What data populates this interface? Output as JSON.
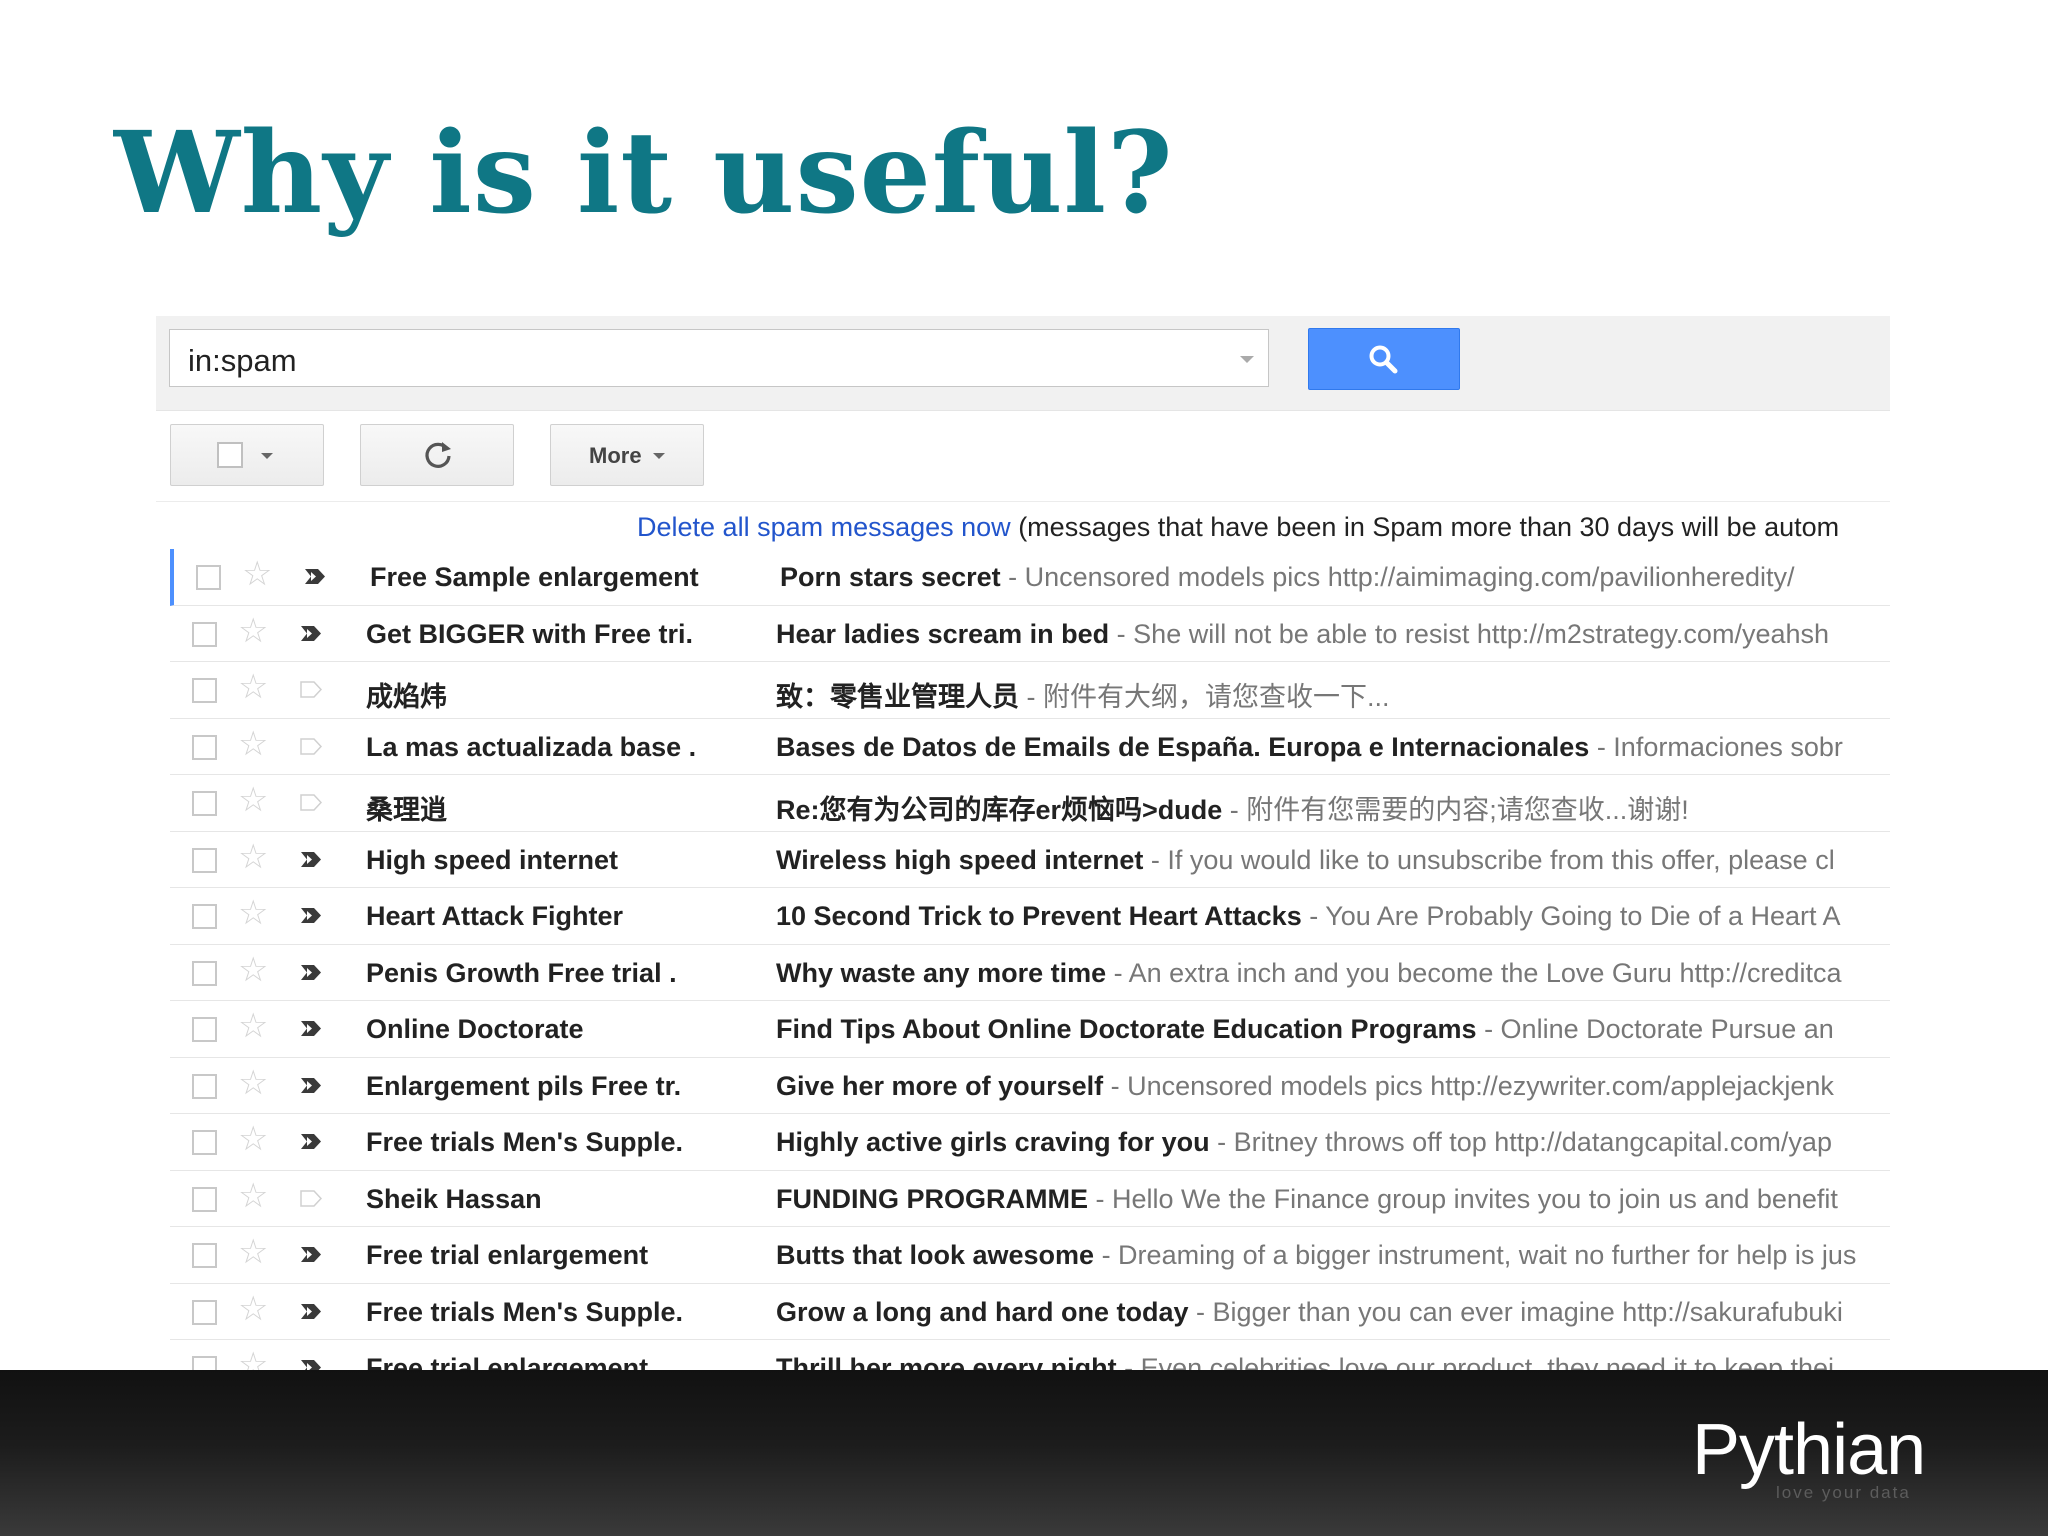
{
  "slide": {
    "title": "Why is it useful?"
  },
  "search": {
    "query": "in:spam"
  },
  "toolbar": {
    "more_label": "More"
  },
  "notice": {
    "link_text": "Delete all spam messages now",
    "text": " (messages that have been in Spam more than 30 days will be autom"
  },
  "emails": [
    {
      "sender": "Free Sample enlargement",
      "subject": "Porn stars secret",
      "snippet": " - Uncensored models pics http://aimimaging.com/pavilionheredity/",
      "important": true
    },
    {
      "sender": "Get BIGGER with Free tri.",
      "subject": "Hear ladies scream in bed",
      "snippet": " - She will not be able to resist http://m2strategy.com/yeahsh",
      "important": true
    },
    {
      "sender": "成焰炜",
      "subject": "致：零售业管理人员",
      "snippet": " - 附件有大纲，请您查收一下...",
      "important": false
    },
    {
      "sender": "La mas actualizada base .",
      "subject": "Bases de Datos de Emails de España. Europa e Internacionales",
      "snippet": " - Informaciones sobr",
      "important": false
    },
    {
      "sender": "桑理逍",
      "subject": "Re:您有为公司的库存er烦恼吗>dude",
      "snippet": " - 附件有您需要的内容;请您查收...谢谢!",
      "important": false
    },
    {
      "sender": "High speed internet",
      "subject": "Wireless high speed internet",
      "snippet": " - If you would like to unsubscribe from this offer, please cl",
      "important": true
    },
    {
      "sender": "Heart Attack Fighter",
      "subject": "10 Second Trick to Prevent Heart Attacks",
      "snippet": " - You Are Probably Going to Die of a Heart A",
      "important": true
    },
    {
      "sender": "Penis Growth Free trial .",
      "subject": "Why waste any more time",
      "snippet": " - An extra inch and you become the Love Guru http://creditca",
      "important": true
    },
    {
      "sender": "Online Doctorate",
      "subject": "Find Tips About Online Doctorate Education Programs",
      "snippet": " - Online Doctorate Pursue an",
      "important": true
    },
    {
      "sender": "Enlargement pils Free tr.",
      "subject": "Give her more of yourself",
      "snippet": " - Uncensored models pics http://ezywriter.com/applejackjenk",
      "important": true
    },
    {
      "sender": "Free trials Men's Supple.",
      "subject": "Highly active girls craving for you",
      "snippet": " - Britney throws off top http://datangcapital.com/yap",
      "important": true
    },
    {
      "sender": "Sheik Hassan",
      "subject": "FUNDING PROGRAMME",
      "snippet": " - Hello We the Finance group invites you to join us and benefit",
      "important": false
    },
    {
      "sender": "Free trial enlargement",
      "subject": "Butts that look awesome",
      "snippet": " - Dreaming of a bigger instrument, wait no further for help is jus",
      "important": true
    },
    {
      "sender": "Free trials Men's Supple.",
      "subject": "Grow a long and hard one today",
      "snippet": " - Bigger than you can ever imagine http://sakurafubuki",
      "important": true
    },
    {
      "sender": "Free trial enlargement",
      "subject": "Thrill her more every night",
      "snippet": " - Even celebrities love our product, they need it to keep thei",
      "important": true
    }
  ],
  "brand": {
    "logo": "Pythian",
    "tagline": "love your data"
  },
  "colors": {
    "title": "#0f7785",
    "search_button": "#4d90fe",
    "link": "#2255cc"
  }
}
